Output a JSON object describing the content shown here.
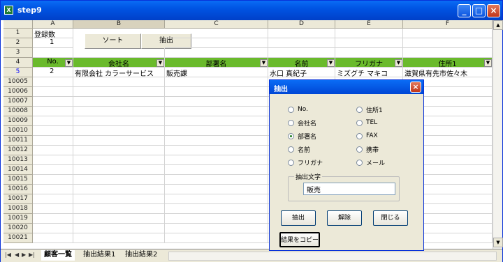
{
  "window": {
    "title": "step9"
  },
  "columns": [
    "A",
    "B",
    "C",
    "D",
    "E",
    "F"
  ],
  "rows": [
    "1",
    "2",
    "3",
    "4",
    "5",
    "10005",
    "10006",
    "10007",
    "10008",
    "10009",
    "10010",
    "10011",
    "10012",
    "10013",
    "10014",
    "10015",
    "10016",
    "10017",
    "10018",
    "10019",
    "10020",
    "10021"
  ],
  "cells": {
    "a1": "登録数",
    "a2": "1"
  },
  "sheet_buttons": {
    "sort": "ソート",
    "extract": "抽出"
  },
  "table": {
    "headers": [
      "No.",
      "会社名",
      "部署名",
      "名前",
      "フリガナ",
      "住所1"
    ],
    "row": [
      "2",
      "有限会社 カラーサービス",
      "販売課",
      "水口 真紀子",
      "ミズグチ マキコ",
      "滋賀県有先市佐々木"
    ]
  },
  "tabs": [
    "顧客一覧",
    "抽出結果1",
    "抽出結果2"
  ],
  "dialog": {
    "title": "抽出",
    "options_left": [
      "No.",
      "会社名",
      "部署名",
      "名前",
      "フリガナ"
    ],
    "options_right": [
      "住所1",
      "TEL",
      "FAX",
      "携帯",
      "メール"
    ],
    "selected": "部署名",
    "group_label": "抽出文字",
    "search_value": "販売",
    "buttons": {
      "extract": "抽出",
      "clear": "解除",
      "close": "閉じる",
      "copy": "結果をコピー"
    }
  },
  "colors": {
    "header_green": "#6aba2c",
    "titlebar": "#0054e3",
    "selected_row": "#0000ff"
  }
}
